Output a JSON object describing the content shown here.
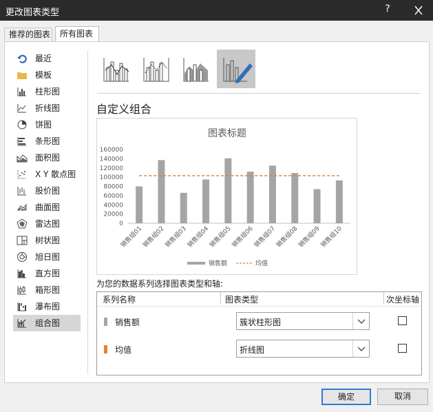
{
  "dialog": {
    "title": "更改图表类型",
    "help": "?",
    "tabs": [
      "推荐的图表",
      "所有图表"
    ]
  },
  "nav": {
    "items": [
      {
        "label": "最近",
        "icon": "recent-icon"
      },
      {
        "label": "模板",
        "icon": "folder-icon"
      },
      {
        "label": "柱形图",
        "icon": "column-chart-icon"
      },
      {
        "label": "折线图",
        "icon": "line-chart-icon"
      },
      {
        "label": "饼图",
        "icon": "pie-chart-icon"
      },
      {
        "label": "条形图",
        "icon": "bar-chart-icon"
      },
      {
        "label": "面积图",
        "icon": "area-chart-icon"
      },
      {
        "label": "X Y 散点图",
        "icon": "scatter-chart-icon"
      },
      {
        "label": "股价图",
        "icon": "stock-chart-icon"
      },
      {
        "label": "曲面图",
        "icon": "surface-chart-icon"
      },
      {
        "label": "雷达图",
        "icon": "radar-chart-icon"
      },
      {
        "label": "树状图",
        "icon": "treemap-chart-icon"
      },
      {
        "label": "旭日图",
        "icon": "sunburst-chart-icon"
      },
      {
        "label": "直方图",
        "icon": "histogram-chart-icon"
      },
      {
        "label": "箱形图",
        "icon": "box-whisker-chart-icon"
      },
      {
        "label": "瀑布图",
        "icon": "waterfall-chart-icon"
      },
      {
        "label": "组合图",
        "icon": "combo-chart-icon"
      }
    ],
    "active_index": 16
  },
  "main": {
    "section_title": "自定义组合",
    "prompt": "为您的数据系列选择图表类型和轴:",
    "table": {
      "headers": [
        "系列名称",
        "图表类型",
        "次坐标轴"
      ],
      "rows": [
        {
          "name": "销售额",
          "color": "#a5a5a5",
          "chart_type": "簇状柱形图",
          "secondary": false
        },
        {
          "name": "均值",
          "color": "#ed7d31",
          "chart_type": "折线图",
          "secondary": false
        }
      ]
    }
  },
  "buttons": {
    "ok": "确定",
    "cancel": "取消"
  },
  "chart_data": {
    "type": "bar",
    "title": "图表标题",
    "categories": [
      "销售组01",
      "销售组02",
      "销售组03",
      "销售组04",
      "销售组05",
      "销售组06",
      "销售组07",
      "销售组08",
      "销售组09",
      "销售组10"
    ],
    "series": [
      {
        "name": "销售额",
        "type": "bar",
        "color": "#a5a5a5",
        "values": [
          80000,
          137000,
          66000,
          95000,
          141000,
          112000,
          125000,
          109000,
          74000,
          93000
        ]
      },
      {
        "name": "均值",
        "type": "line",
        "color": "#ed7d31",
        "dashed": true,
        "values": [
          103200,
          103200,
          103200,
          103200,
          103200,
          103200,
          103200,
          103200,
          103200,
          103200
        ]
      }
    ],
    "yticks": [
      "0",
      "20000",
      "40000",
      "60000",
      "80000",
      "100000",
      "120000",
      "140000",
      "160000"
    ],
    "ylim": [
      0,
      160000
    ],
    "legend": "bottom"
  }
}
